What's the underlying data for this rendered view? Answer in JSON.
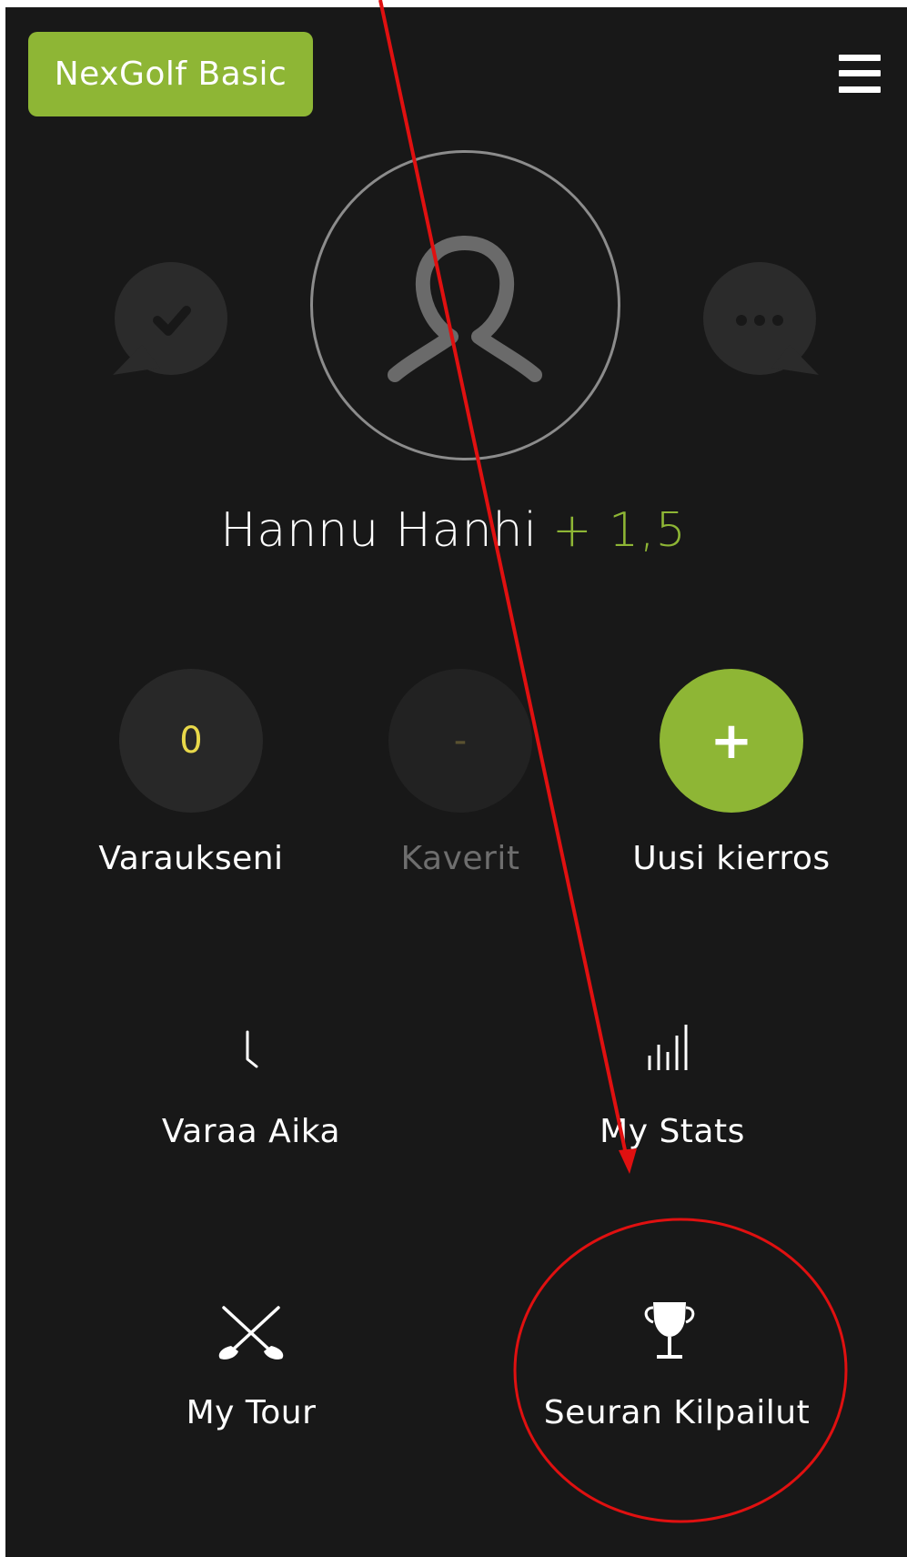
{
  "header": {
    "brand_label": "NexGolf Basic",
    "menu_icon": "hamburger-menu-icon"
  },
  "profile": {
    "name": "Hannu Hanhi",
    "handicap": "+ 1,5",
    "left_bubble_icon": "checkmark-chat-icon",
    "right_bubble_icon": "ellipsis-chat-icon",
    "avatar_icon": "user-silhouette-icon"
  },
  "quick_actions": [
    {
      "value": "0",
      "label": "Varaukseni"
    },
    {
      "value": "-",
      "label": "Kaverit"
    },
    {
      "value": "+",
      "label": "Uusi kierros"
    }
  ],
  "tiles": [
    {
      "icon": "clock-hand-icon",
      "label": "Varaa Aika"
    },
    {
      "icon": "bar-chart-icon",
      "label": "My Stats"
    },
    {
      "icon": "crossed-golf-clubs-icon",
      "label": "My Tour"
    },
    {
      "icon": "trophy-icon",
      "label": "Seuran Kilpailut"
    }
  ],
  "colors": {
    "background": "#181818",
    "accent_green": "#8eb635",
    "counter_yellow": "#e8d84a",
    "muted_text": "#6e6e6e",
    "annotation_red": "#e01010"
  }
}
